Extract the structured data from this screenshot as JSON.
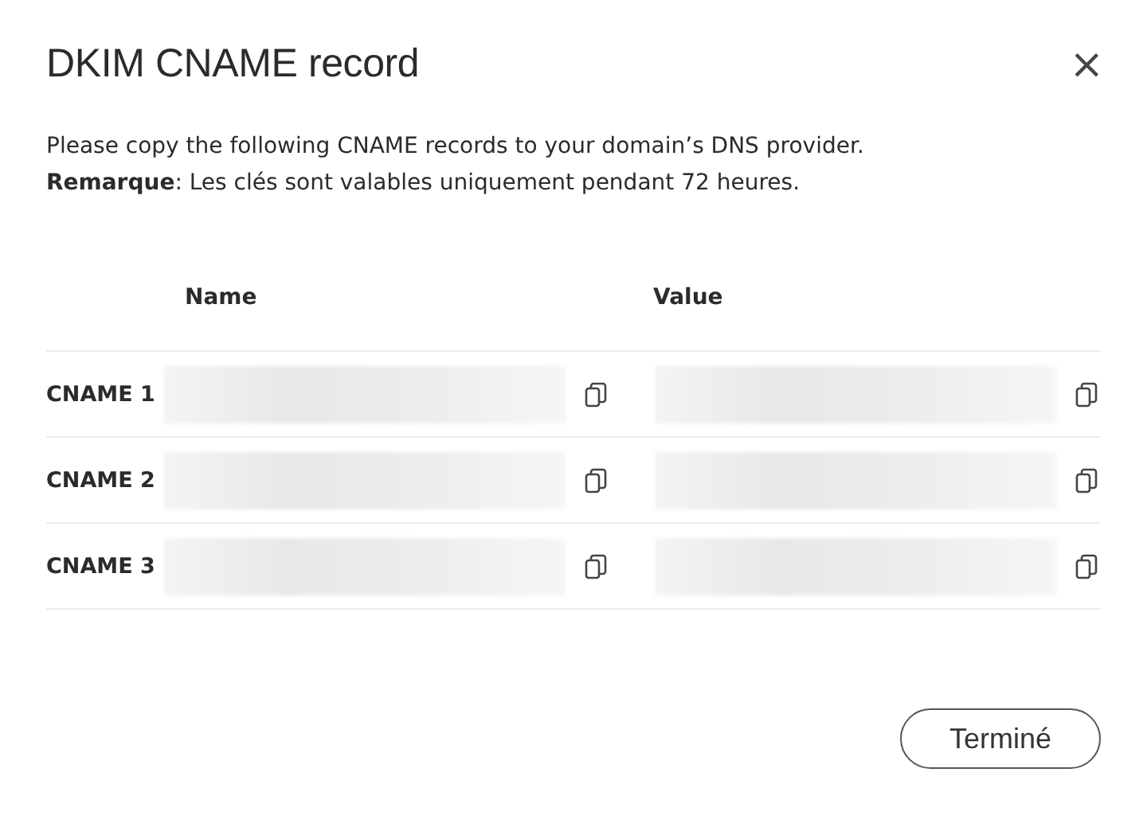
{
  "dialog": {
    "title": "DKIM CNAME record",
    "close": "×",
    "intro": [
      "Please copy the following CNAME records to your domain’s DNS provider.",
      "**Remarque**: Les clés sont valables uniquement pendant 72 heures."
    ],
    "table": {
      "columns": [
        "Name",
        "Value"
      ],
      "rows": [
        {
          "label": "CNAME 1"
        },
        {
          "label": "CNAME 2"
        },
        {
          "label": "CNAME 3"
        }
      ]
    },
    "buttons": [
      "Terminé"
    ]
  }
}
